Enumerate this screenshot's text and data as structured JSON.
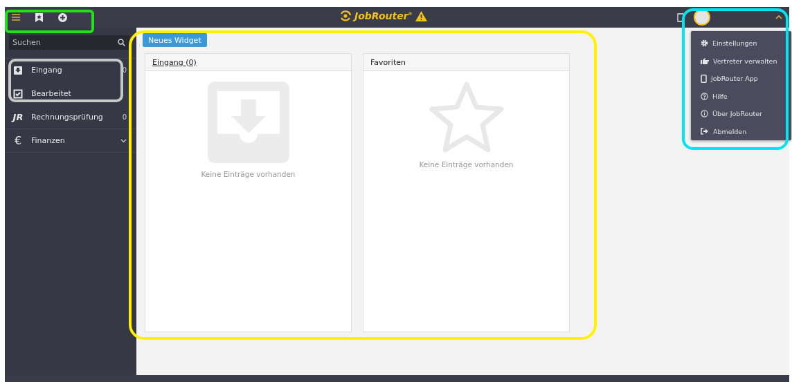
{
  "header": {
    "logo_text": "JobRouter",
    "logo_mark": "®",
    "warning": true
  },
  "sidebar": {
    "search": {
      "placeholder": "Suchen"
    },
    "items": [
      {
        "label": "Eingang",
        "kind": "inbox",
        "count": "0",
        "expandable": false
      },
      {
        "label": "Bearbeitet",
        "kind": "check",
        "expandable": false
      },
      {
        "label": "Rechnungsprüfung",
        "kind": "monogram",
        "glyph": "JR",
        "count": "0",
        "expandable": false
      },
      {
        "label": "Finanzen",
        "kind": "currency",
        "glyph": "€",
        "expandable": true
      }
    ]
  },
  "toolbar": {
    "button": "Neues Widget"
  },
  "widgets": [
    {
      "title": "Eingang (0)",
      "link": true,
      "kind": "inbox",
      "empty_text": "Keine Einträge vorhanden"
    },
    {
      "title": "Favoriten",
      "link": false,
      "kind": "star",
      "empty_text": "Keine Einträge vorhanden"
    }
  ],
  "user_menu": {
    "expanded": true,
    "items": [
      {
        "label": "Einstellungen",
        "kind": "gear"
      },
      {
        "label": "Vertreter verwalten",
        "kind": "hand"
      },
      {
        "label": "JobRouter App",
        "kind": "phone"
      },
      {
        "label": "Hilfe",
        "kind": "question"
      },
      {
        "label": "Über JobRouter",
        "kind": "info"
      },
      {
        "label": "Abmelden",
        "kind": "signout"
      }
    ]
  },
  "highlights": [
    {
      "color": "#22e01a"
    },
    {
      "color": "#c8c8c8"
    },
    {
      "color": "#fff200"
    },
    {
      "color": "#00e5f0"
    }
  ]
}
